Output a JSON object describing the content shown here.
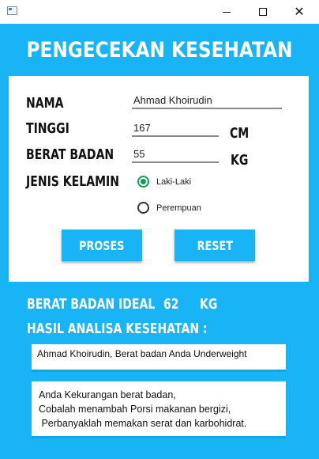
{
  "window": {
    "minimize_glyph": "",
    "close_glyph": "✕"
  },
  "header": {
    "title": "PENGECEKAN KESEHATAN"
  },
  "form": {
    "nama_label": "NAMA",
    "nama_value": "Ahmad Khoirudin",
    "tinggi_label": "TINGGI",
    "tinggi_value": "167",
    "tinggi_unit": "CM",
    "berat_label": "BERAT BADAN",
    "berat_value": "55",
    "berat_unit": "KG",
    "gender_label": "JENIS KELAMIN",
    "gender_options": [
      {
        "label": "Laki-Laki",
        "selected": true
      },
      {
        "label": "Perempuan",
        "selected": false
      }
    ]
  },
  "buttons": {
    "proses": "PROSES",
    "reset": "RESET"
  },
  "result": {
    "ideal_label": "BERAT BADAN IDEAL",
    "ideal_value": "62",
    "ideal_unit": "KG",
    "analysis_label": "HASIL ANALISA KESEHATAN :",
    "summary": "Ahmad Khoirudin, Berat badan Anda Underweight",
    "advice_lines": [
      "Anda Kekurangan berat badan,",
      "Cobalah menambah Porsi makanan bergizi,",
      " Perbanyaklah memakan serat dan karbohidrat."
    ]
  },
  "colors": {
    "accent": "#19b4f6",
    "radio_selected": "#0f9d58"
  },
  "icons": {
    "app": "window-app-icon",
    "minimize": "minimize-icon",
    "maximize": "maximize-icon",
    "close": "close-icon"
  }
}
